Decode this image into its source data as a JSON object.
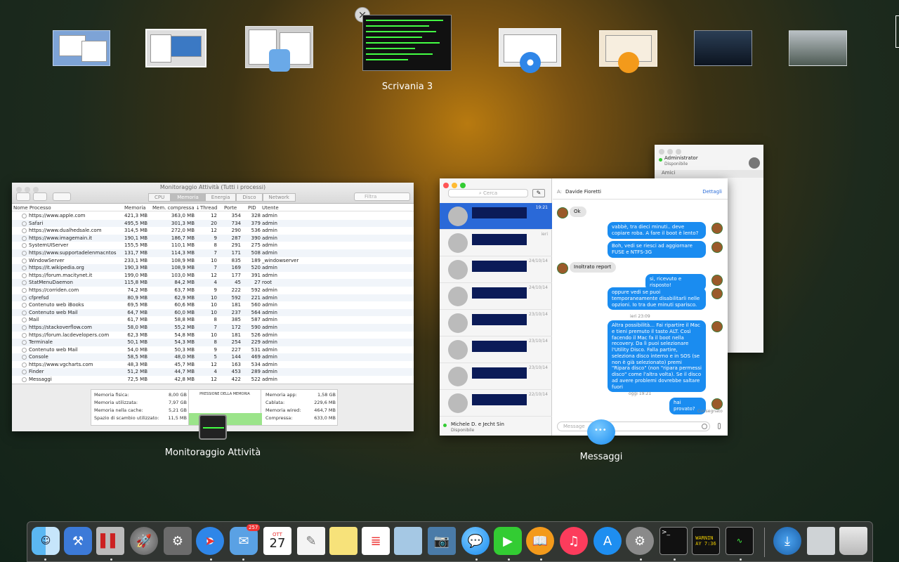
{
  "spaces": {
    "current_label": "Scrivania 3",
    "close_symbol": "×"
  },
  "activity_monitor": {
    "title": "Monitoraggio Attività (Tutti i processi)",
    "tabs": [
      "CPU",
      "Memoria",
      "Energia",
      "Disco",
      "Network"
    ],
    "selected_tab": "Memoria",
    "search_placeholder": "Filtra",
    "columns": [
      "Nome Processo",
      "Memoria",
      "Mem. compressa ↓",
      "Thread",
      "Porte",
      "PID",
      "Utente"
    ],
    "rows": [
      [
        "https://www.apple.com",
        "421,3 MB",
        "363,0 MB",
        "12",
        "354",
        "328",
        "admin"
      ],
      [
        "Safari",
        "495,5 MB",
        "301,3 MB",
        "20",
        "734",
        "379",
        "admin"
      ],
      [
        "https://www.dualhedsale.com",
        "314,5 MB",
        "272,0 MB",
        "12",
        "290",
        "536",
        "admin"
      ],
      [
        "https://www.imagemain.it",
        "190,1 MB",
        "186,7 MB",
        "9",
        "287",
        "390",
        "admin"
      ],
      [
        "SystemUIServer",
        "155,5 MB",
        "110,1 MB",
        "8",
        "291",
        "275",
        "admin"
      ],
      [
        "https://www.supportadelenmacntos",
        "131,7 MB",
        "114,3 MB",
        "7",
        "171",
        "508",
        "admin"
      ],
      [
        "WindowServer",
        "233,1 MB",
        "108,9 MB",
        "10",
        "835",
        "189",
        "_windowserver"
      ],
      [
        "https://it.wikipedia.org",
        "190,3 MB",
        "108,9 MB",
        "7",
        "169",
        "520",
        "admin"
      ],
      [
        "https://forum.macitynet.it",
        "199,0 MB",
        "103,0 MB",
        "12",
        "177",
        "391",
        "admin"
      ],
      [
        "StatMenuDaemon",
        "115,8 MB",
        "84,2 MB",
        "4",
        "45",
        "27",
        "root"
      ],
      [
        "https://corriden.com",
        "74,2 MB",
        "63,7 MB",
        "9",
        "222",
        "592",
        "admin"
      ],
      [
        "cfprefsd",
        "80,9 MB",
        "62,9 MB",
        "10",
        "592",
        "221",
        "admin"
      ],
      [
        "Contenuto web iBooks",
        "69,5 MB",
        "60,6 MB",
        "10",
        "181",
        "560",
        "admin"
      ],
      [
        "Contenuto web Mail",
        "64,7 MB",
        "60,0 MB",
        "10",
        "237",
        "564",
        "admin"
      ],
      [
        "Mail",
        "61,7 MB",
        "58,8 MB",
        "8",
        "385",
        "587",
        "admin"
      ],
      [
        "https://stackoverflow.com",
        "58,0 MB",
        "55,2 MB",
        "7",
        "172",
        "590",
        "admin"
      ],
      [
        "https://forum.lacdevelopers.com",
        "62,3 MB",
        "54,8 MB",
        "10",
        "181",
        "526",
        "admin"
      ],
      [
        "Terminale",
        "50,1 MB",
        "54,3 MB",
        "8",
        "254",
        "229",
        "admin"
      ],
      [
        "Contenuto web Mail",
        "54,0 MB",
        "50,3 MB",
        "9",
        "227",
        "531",
        "admin"
      ],
      [
        "Console",
        "58,5 MB",
        "48,0 MB",
        "5",
        "144",
        "469",
        "admin"
      ],
      [
        "https://www.vgcharts.com",
        "48,3 MB",
        "45,7 MB",
        "12",
        "163",
        "534",
        "admin"
      ],
      [
        "Finder",
        "51,2 MB",
        "44,7 MB",
        "4",
        "453",
        "289",
        "admin"
      ],
      [
        "Messaggi",
        "72,5 MB",
        "42,8 MB",
        "12",
        "422",
        "522",
        "admin"
      ]
    ],
    "memory": {
      "left": [
        [
          "Memoria fisica:",
          "8,00 GB"
        ],
        [
          "Memoria utilizzata:",
          "7,97 GB"
        ],
        [
          "Memoria nella cache:",
          "5,21 GB"
        ],
        [
          "Spazio di scambio utilizzato:",
          "11,5 MB"
        ]
      ],
      "pressure_title": "PRESSIONE DELLA MEMORIA",
      "right": [
        [
          "Memoria app:",
          "1,58 GB"
        ],
        [
          "Cablata:",
          "229,6 MB"
        ],
        [
          "Memoria wired:",
          "464,7 MB"
        ],
        [
          "Compressa:",
          "633,0 MB"
        ]
      ]
    },
    "window_label": "Monitoraggio Attività"
  },
  "messages": {
    "search_placeholder": "Cerca",
    "to_label": "A:",
    "contact": "Davide Fioretti",
    "details": "Dettagli",
    "conv_times": [
      "19:21",
      "ieri",
      "24/10/14",
      "24/10/14",
      "23/10/14",
      "23/10/14",
      "23/10/14",
      "22/10/14"
    ],
    "bubbles": [
      {
        "dir": "in",
        "text": "Ok"
      },
      {
        "dir": "out",
        "text": "vabbè, tra dieci minuti.. deve copiare roba. A fare il boot è lento?"
      },
      {
        "dir": "out",
        "text": "Boh, vedi se riesci ad aggiornare FUSE e NTFS-3G"
      },
      {
        "dir": "in",
        "text": "Inoltrato report"
      },
      {
        "dir": "out",
        "text": "si, ricevuto e risposto!"
      },
      {
        "dir": "out",
        "text": "oppure vedi se puoi temporaneamente disabilitarli nelle opzioni. Io tra due minuti sparisco."
      },
      {
        "dir": "out",
        "text": "Altra possibilità… Fai ripartire il Mac e tieni premuto il tasto ALT. Così facendo il Mac fa il boot nella recovery. Da lì puoi selezionare l'Utility Disco. Falla partire, seleziona disco interno e in SOS (se non è già selezionato) premi \"Ripara disco\" (non \"ripara permessi disco\" come l'altra volta). Se il disco ad avere problemi dovrebbe saltare fuori"
      },
      {
        "dir": "out",
        "text": "hai provato?"
      }
    ],
    "time_yesterday": "ieri 23:09",
    "time_today": "oggi 19:21",
    "delivered": "Consegnato",
    "footer_name": "Michele D. e Jecht Sin",
    "footer_status": "Disponibile",
    "input_placeholder": "Message",
    "buddy_name": "Administrator",
    "buddy_status": "Disponibile",
    "buddy_group": "Amici",
    "window_label": "Messaggi"
  },
  "dock": {
    "mail_badge": "257",
    "calendar_month": "OTT",
    "calendar_day": "27",
    "console_text": "WARNIN\nAY 7:36"
  }
}
